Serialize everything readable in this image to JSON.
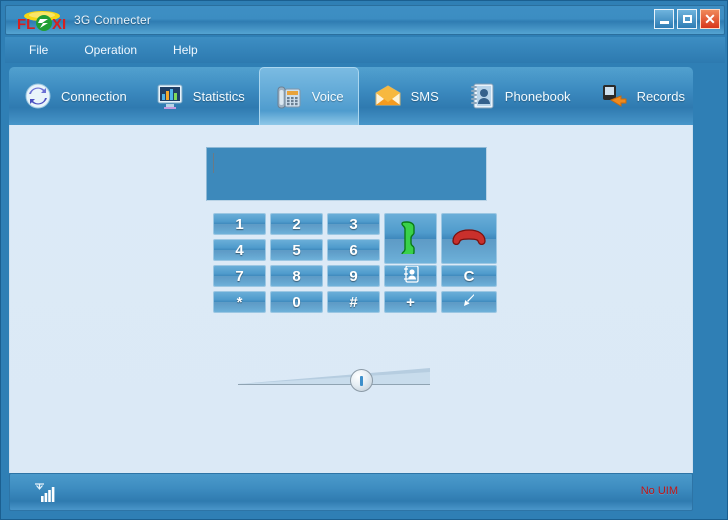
{
  "window": {
    "title": "3G Connecter",
    "logo_text": "FLEXI",
    "controls": {
      "minimize": "minimize-button",
      "maximize": "maximize-button",
      "close": "✕"
    }
  },
  "menu": {
    "items": [
      {
        "label": "File"
      },
      {
        "label": "Operation"
      },
      {
        "label": "Help"
      }
    ]
  },
  "toolbar": {
    "tabs": [
      {
        "label": "Connection",
        "icon": "sync-arrows-icon",
        "active": false
      },
      {
        "label": "Statistics",
        "icon": "bar-chart-monitor-icon",
        "active": false
      },
      {
        "label": "Voice",
        "icon": "desk-phone-icon",
        "active": true
      },
      {
        "label": "SMS",
        "icon": "open-envelope-icon",
        "active": false
      },
      {
        "label": "Phonebook",
        "icon": "address-book-icon",
        "active": false
      },
      {
        "label": "Records",
        "icon": "device-transfer-icon",
        "active": false
      }
    ]
  },
  "voice": {
    "number_input": {
      "value": "",
      "placeholder": ""
    },
    "keys": [
      {
        "label": "1",
        "name": "key-1",
        "kind": "digit"
      },
      {
        "label": "2",
        "name": "key-2",
        "kind": "digit"
      },
      {
        "label": "3",
        "name": "key-3",
        "kind": "digit"
      },
      {
        "label": "",
        "name": "call-button",
        "kind": "call"
      },
      {
        "label": "",
        "name": "hangup-button",
        "kind": "hangup"
      },
      {
        "label": "4",
        "name": "key-4",
        "kind": "digit"
      },
      {
        "label": "5",
        "name": "key-5",
        "kind": "digit"
      },
      {
        "label": "6",
        "name": "key-6",
        "kind": "digit"
      },
      {
        "label": "7",
        "name": "key-7",
        "kind": "digit"
      },
      {
        "label": "8",
        "name": "key-8",
        "kind": "digit"
      },
      {
        "label": "9",
        "name": "key-9",
        "kind": "digit"
      },
      {
        "label": "",
        "name": "phonebook-button",
        "kind": "phonebook"
      },
      {
        "label": "C",
        "name": "clear-button",
        "kind": "text"
      },
      {
        "label": "*",
        "name": "key-star",
        "kind": "digit"
      },
      {
        "label": "0",
        "name": "key-0",
        "kind": "digit"
      },
      {
        "label": "#",
        "name": "key-hash",
        "kind": "digit"
      },
      {
        "label": "+",
        "name": "key-plus",
        "kind": "text"
      },
      {
        "label": "",
        "name": "backspace-button",
        "kind": "backarrow"
      }
    ],
    "volume_slider": {
      "label": "volume-slider",
      "value": 58
    }
  },
  "statusbar": {
    "signal_icon": "signal-bars-icon",
    "status_text": "No UIM",
    "status_color": "#c21515"
  }
}
